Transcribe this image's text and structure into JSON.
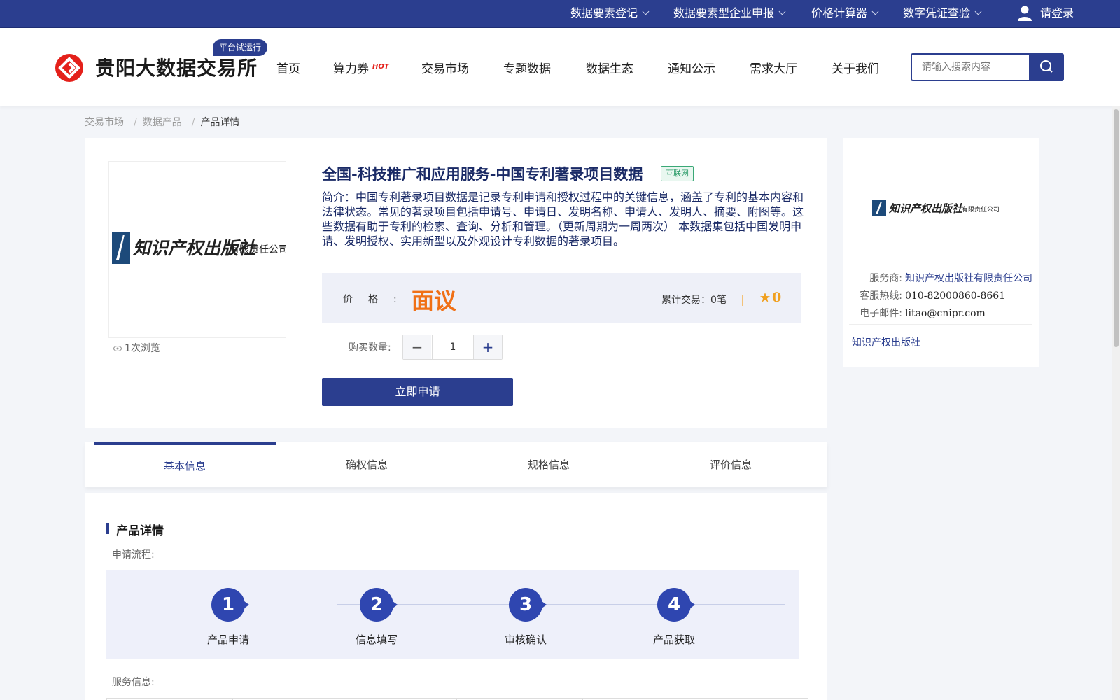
{
  "topbar": {
    "items": [
      "数据要素登记",
      "数据要素型企业申报",
      "价格计算器",
      "数字凭证查验"
    ],
    "login": "请登录"
  },
  "header": {
    "site_title": "贵阳大数据交易所",
    "trial_badge": "平台试运行",
    "nav": [
      "首页",
      "算力券",
      "交易市场",
      "专题数据",
      "数据生态",
      "通知公示",
      "需求大厅",
      "关于我们"
    ],
    "hot_badge": "HOT",
    "search_placeholder": "请输入搜索内容"
  },
  "breadcrumb": [
    "交易市场",
    "数据产品",
    "产品详情"
  ],
  "product": {
    "title": "全国-科技推广和应用服务-中国专利著录项目数据",
    "tag": "互联网",
    "description": "简介：中国专利著录项目数据是记录专利申请和授权过程中的关键信息，涵盖了专利的基本内容和法律状态。常见的著录项目包括申请号、申请日、发明名称、申请人、发明人、摘要、附图等。这些数据有助于专利的检索、查询、分析和管理。（更新周期为一周两次） 本数据集包括中国发明申请、发明授权、实用新型以及外观设计专利数据的著录项目。",
    "image_logo_text": "知识产权出版社",
    "image_logo_sub": "有限责任公司",
    "views": "1次浏览",
    "price_label": "价格:",
    "price_value": "面议",
    "trade_label": "累计交易：0笔",
    "rating": "0",
    "qty_label": "购买数量:",
    "qty_value": "1",
    "apply_button": "立即申请"
  },
  "provider": {
    "logo_text": "知识产权出版社",
    "logo_sub": "有限责任公司",
    "rows": [
      {
        "key": "服务商:",
        "value": "知识产权出版社有限责任公司"
      },
      {
        "key": "客服热线:",
        "value": "010-82000860-8661"
      },
      {
        "key": "电子邮件:",
        "value": "litao@cnipr.com"
      }
    ],
    "company": "知识产权出版社"
  },
  "tabs": [
    "基本信息",
    "确权信息",
    "规格信息",
    "评价信息"
  ],
  "details": {
    "section_title": "产品详情",
    "process_label": "申请流程:",
    "steps": [
      {
        "num": "1",
        "label": "产品申请"
      },
      {
        "num": "2",
        "label": "信息填写"
      },
      {
        "num": "3",
        "label": "审核确认"
      },
      {
        "num": "4",
        "label": "产品获取"
      }
    ],
    "service_label": "服务信息:"
  },
  "colors": {
    "primary": "#2b3e8f",
    "price": "#f07016",
    "tag_green": "#2a9b68",
    "hot_red": "#e4201a"
  }
}
